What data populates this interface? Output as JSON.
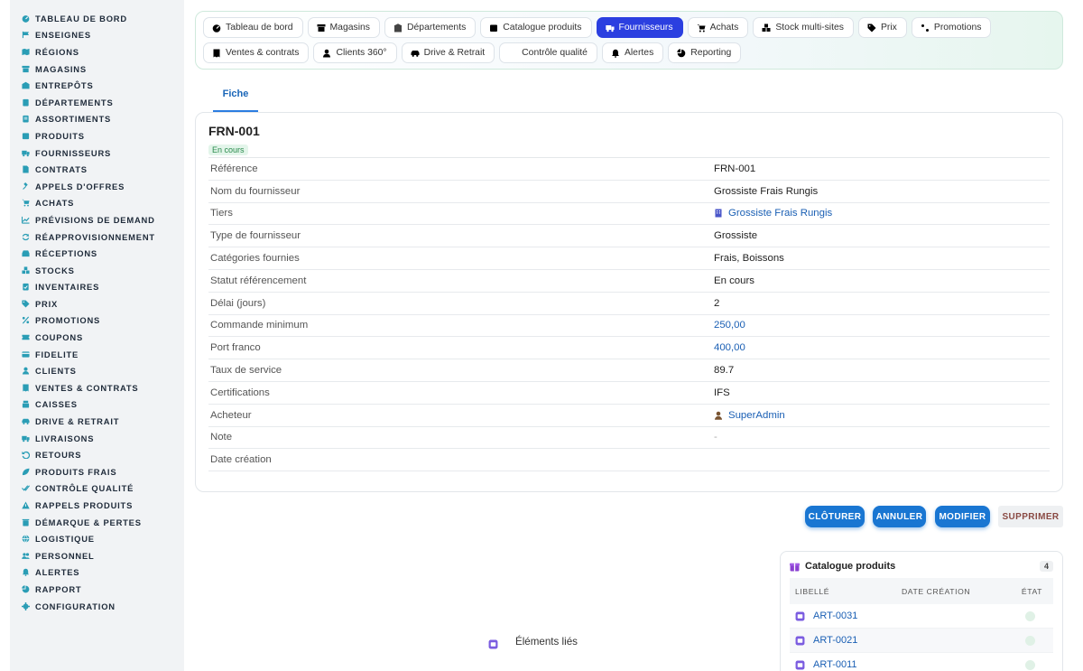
{
  "sidebar": {
    "items": [
      {
        "label": "TABLEAU DE BORD",
        "icon": "dashboard-icon"
      },
      {
        "label": "ENSEIGNES",
        "icon": "flag-icon"
      },
      {
        "label": "RÉGIONS",
        "icon": "map-icon"
      },
      {
        "label": "MAGASINS",
        "icon": "store-icon"
      },
      {
        "label": "ENTREPÔTS",
        "icon": "warehouse-icon"
      },
      {
        "label": "DÉPARTEMENTS",
        "icon": "clipboard-icon"
      },
      {
        "label": "ASSORTIMENTS",
        "icon": "list-icon"
      },
      {
        "label": "PRODUITS",
        "icon": "box-icon"
      },
      {
        "label": "FOURNISSEURS",
        "icon": "truck-icon"
      },
      {
        "label": "CONTRATS",
        "icon": "document-icon"
      },
      {
        "label": "APPELS D'OFFRES",
        "icon": "gavel-icon"
      },
      {
        "label": "ACHATS",
        "icon": "cart-icon"
      },
      {
        "label": "PRÉVISIONS DE DEMAND",
        "icon": "chart-line-icon"
      },
      {
        "label": "RÉAPPROVISIONNEMENT",
        "icon": "sync-icon"
      },
      {
        "label": "RÉCEPTIONS",
        "icon": "inbox-icon"
      },
      {
        "label": "STOCKS",
        "icon": "boxes-icon"
      },
      {
        "label": "INVENTAIRES",
        "icon": "clipboard-check-icon"
      },
      {
        "label": "PRIX",
        "icon": "tag-icon"
      },
      {
        "label": "PROMOTIONS",
        "icon": "percent-icon"
      },
      {
        "label": "COUPONS",
        "icon": "ticket-icon"
      },
      {
        "label": "FIDELITE",
        "icon": "card-icon"
      },
      {
        "label": "CLIENTS",
        "icon": "user-icon"
      },
      {
        "label": "VENTES & CONTRATS",
        "icon": "receipt-icon"
      },
      {
        "label": "CAISSES",
        "icon": "register-icon"
      },
      {
        "label": "DRIVE & RETRAIT",
        "icon": "car-icon"
      },
      {
        "label": "LIVRAISONS",
        "icon": "delivery-icon"
      },
      {
        "label": "RETOURS",
        "icon": "undo-icon"
      },
      {
        "label": "PRODUITS FRAIS",
        "icon": "leaf-icon"
      },
      {
        "label": "CONTRÔLE QUALITÉ",
        "icon": "check-double-icon"
      },
      {
        "label": "RAPPELS PRODUITS",
        "icon": "warning-icon"
      },
      {
        "label": "DÉMARQUE & PERTES",
        "icon": "trash-icon"
      },
      {
        "label": "LOGISTIQUE",
        "icon": "globe-icon"
      },
      {
        "label": "PERSONNEL",
        "icon": "users-icon"
      },
      {
        "label": "ALERTES",
        "icon": "bell-icon"
      },
      {
        "label": "RAPPORT",
        "icon": "pie-icon"
      },
      {
        "label": "CONFIGURATION",
        "icon": "gear-icon"
      }
    ]
  },
  "tabs": {
    "row1": [
      {
        "label": "Tableau de bord",
        "icon": "dashboard-icon"
      },
      {
        "label": "Magasins",
        "icon": "store-icon"
      },
      {
        "label": "Départements",
        "icon": "building-icon"
      },
      {
        "label": "Catalogue produits",
        "icon": "box-icon"
      },
      {
        "label": "Fournisseurs",
        "icon": "truck-icon"
      },
      {
        "label": "Achats",
        "icon": "cart-icon"
      },
      {
        "label": "Stock multi-sites",
        "icon": "boxes-icon"
      },
      {
        "label": "Prix",
        "icon": "tag-icon"
      },
      {
        "label": "Promotions",
        "icon": "percent-icon"
      }
    ],
    "row2": [
      {
        "label": "Ventes & contrats",
        "icon": "receipt-icon"
      },
      {
        "label": "Clients 360°",
        "icon": "user-icon"
      },
      {
        "label": "Drive & Retrait",
        "icon": "car-icon"
      },
      {
        "label": "Contrôle qualité",
        "icon": "check-double-icon"
      },
      {
        "label": "Alertes",
        "icon": "bell-icon"
      },
      {
        "label": "Reporting",
        "icon": "pie-icon"
      }
    ],
    "active": "Fournisseurs"
  },
  "subtab": {
    "label": "Fiche"
  },
  "record": {
    "code": "FRN-001",
    "status_badge": "En cours",
    "fields": [
      {
        "label": "Référence",
        "value": "FRN-001",
        "kind": "text"
      },
      {
        "label": "Nom du fournisseur",
        "value": "Grossiste Frais Rungis",
        "kind": "text"
      },
      {
        "label": "Tiers",
        "value": "Grossiste Frais Rungis",
        "kind": "link",
        "icon": "company-icon"
      },
      {
        "label": "Type de fournisseur",
        "value": "Grossiste",
        "kind": "text"
      },
      {
        "label": "Catégories fournies",
        "value": "Frais, Boissons",
        "kind": "text"
      },
      {
        "label": "Statut référencement",
        "value": "En cours",
        "kind": "text"
      },
      {
        "label": "Délai (jours)",
        "value": "2",
        "kind": "text"
      },
      {
        "label": "Commande minimum",
        "value": "250,00",
        "kind": "money"
      },
      {
        "label": "Port franco",
        "value": "400,00",
        "kind": "money"
      },
      {
        "label": "Taux de service",
        "value": "89.7",
        "kind": "text"
      },
      {
        "label": "Certifications",
        "value": "IFS",
        "kind": "text"
      },
      {
        "label": "Acheteur",
        "value": "SuperAdmin",
        "kind": "link",
        "icon": "user-icon"
      },
      {
        "label": "Note",
        "value": "-",
        "kind": "muted"
      },
      {
        "label": "Date création",
        "value": "",
        "kind": "text"
      }
    ]
  },
  "actions": {
    "close": "CLÔTURER",
    "cancel": "ANNULER",
    "edit": "MODIFIER",
    "delete": "SUPPRIMER"
  },
  "linked": {
    "label": "Éléments liés"
  },
  "catalogue": {
    "title": "Catalogue produits",
    "count": "4",
    "columns": [
      "LIBELLÉ",
      "DATE CRÉATION",
      "ÉTAT"
    ],
    "rows": [
      {
        "label": "ART-0031",
        "date": ""
      },
      {
        "label": "ART-0021",
        "date": ""
      },
      {
        "label": "ART-0011",
        "date": ""
      }
    ]
  },
  "colors": {
    "accent": "#2b3fe0",
    "button": "#1976d2",
    "link": "#1a5fb4",
    "sidebar_bg": "#f1f3f5",
    "badge_green": "#2a8a4c"
  }
}
